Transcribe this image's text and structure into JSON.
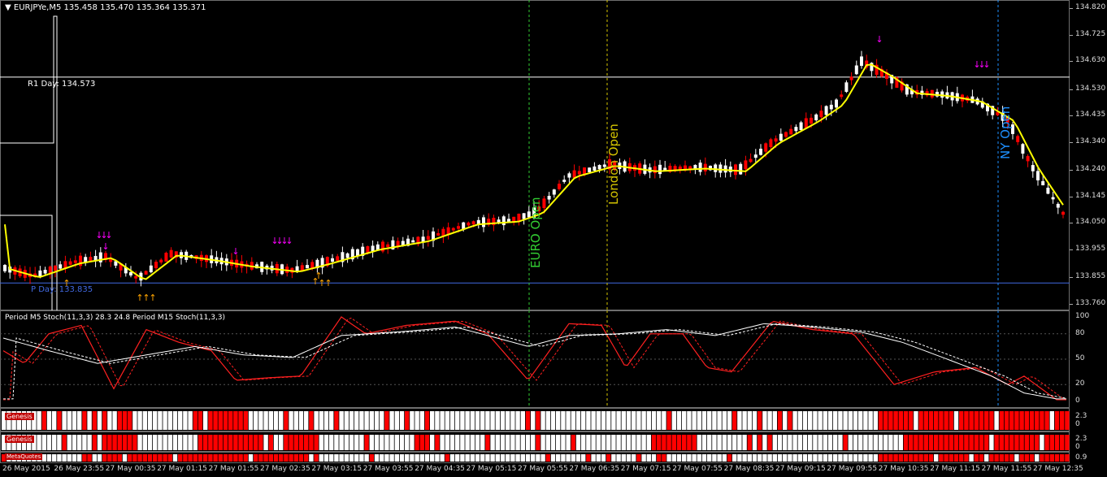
{
  "header": {
    "symbol_menu_icon": "triangle-down-icon",
    "symbol": "EURJPYe,M5",
    "ohlc": "135.458 135.470 135.364 135.371"
  },
  "levels": {
    "r1": {
      "label": "R1 Day: 134.573",
      "value": 134.573,
      "color": "#ffffff"
    },
    "pivot": {
      "label": "P Day: 133.835",
      "value": 133.835,
      "color": "#4169e1"
    }
  },
  "sessions": {
    "euro": {
      "label": "EURO Open",
      "color": "#32cd32"
    },
    "london": {
      "label": "London Open",
      "color": "#d4c400"
    },
    "ny": {
      "label": "NY Open",
      "color": "#1e90ff"
    }
  },
  "price_scale": [
    "134.820",
    "134.725",
    "134.630",
    "134.530",
    "134.435",
    "134.340",
    "134.240",
    "134.145",
    "134.050",
    "133.955",
    "133.855",
    "133.760"
  ],
  "stoch": {
    "label": "Period M5 Stoch(11,3,3) 28.3 24.8  Period M15 Stoch(11,3,3)",
    "scale": [
      "100",
      "80",
      "50",
      "20",
      "0"
    ]
  },
  "genesis": [
    {
      "label": "Genesis",
      "scale_top": "2.3",
      "scale_bottom": "0"
    },
    {
      "label": "Genesis",
      "scale_top": "2.3",
      "scale_bottom": "0"
    },
    {
      "label": "MetaQuotes",
      "scale_top": "0.9",
      "scale_bottom": ""
    }
  ],
  "time_axis": [
    "26 May 2015",
    "26 May 23:55",
    "27 May 00:35",
    "27 May 01:15",
    "27 May 01:55",
    "27 May 02:35",
    "27 May 03:15",
    "27 May 03:55",
    "27 May 04:35",
    "27 May 05:15",
    "27 May 05:55",
    "27 May 06:35",
    "27 May 07:15",
    "27 May 07:55",
    "27 May 08:35",
    "27 May 09:15",
    "27 May 09:55",
    "27 May 10:35",
    "27 May 11:15",
    "27 May 11:55",
    "27 May 12:35"
  ],
  "colors": {
    "bull": "#ffffff",
    "bear": "#ff0000",
    "ma": "#ffff00",
    "arrow_down": "#ff00ff",
    "arrow_up": "#ffa500",
    "grid": "#6e6e6e"
  }
}
